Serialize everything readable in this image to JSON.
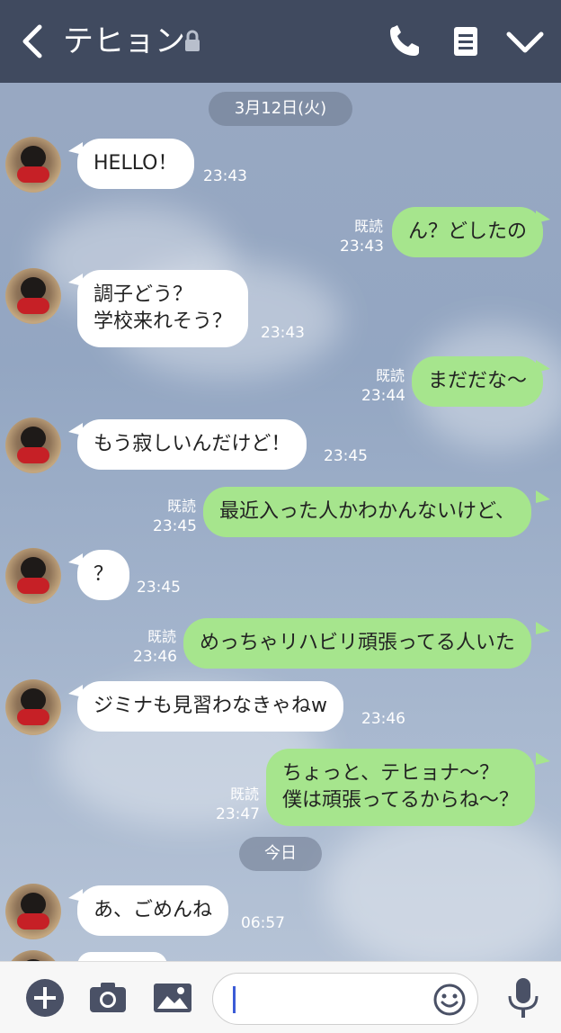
{
  "header": {
    "title": "テヒョン",
    "back_icon": "chevron-left-icon",
    "lock_icon": "lock-icon",
    "actions": [
      "phone-icon",
      "menu-icon",
      "chevron-down-icon"
    ]
  },
  "dates": [
    "3月12日(火)",
    "今日"
  ],
  "messages": [
    {
      "side": "left",
      "lines": [
        "HELLO！"
      ],
      "time": "23:43"
    },
    {
      "side": "right",
      "lines": [
        "ん？どしたの"
      ],
      "read": "既読",
      "time": "23:43"
    },
    {
      "side": "left",
      "lines": [
        "調子どう？",
        "学校来れそう？"
      ],
      "time": "23:43"
    },
    {
      "side": "right",
      "lines": [
        "まだだな〜"
      ],
      "read": "既読",
      "time": "23:44"
    },
    {
      "side": "left",
      "lines": [
        "もう寂しいんだけど！"
      ],
      "time": "23:45"
    },
    {
      "side": "right",
      "lines": [
        "最近入った人かわかんないけど、"
      ],
      "read": "既読",
      "time": "23:45"
    },
    {
      "side": "left",
      "lines": [
        "？"
      ],
      "time": "23:45"
    },
    {
      "side": "right",
      "lines": [
        "めっちゃリハビリ頑張ってる人いた"
      ],
      "read": "既読",
      "time": "23:46"
    },
    {
      "side": "left",
      "lines": [
        "ジミナも見習わなきゃねw"
      ],
      "time": "23:46"
    },
    {
      "side": "right",
      "lines": [
        "ちょっと、テヒョナ〜？",
        "僕は頑張ってるからね〜？"
      ],
      "read": "既読",
      "time": "23:47"
    },
    {
      "side": "left",
      "lines": [
        "あ、ごめんね"
      ],
      "time": "06:57"
    }
  ],
  "bottom": {
    "icons": [
      "plus-icon",
      "camera-icon",
      "image-icon",
      "emoji-icon",
      "microphone-icon"
    ],
    "input_value": ""
  },
  "colors": {
    "header": "#404a5f",
    "bubble_right": "#a6e58d",
    "bubble_left": "#ffffff"
  }
}
